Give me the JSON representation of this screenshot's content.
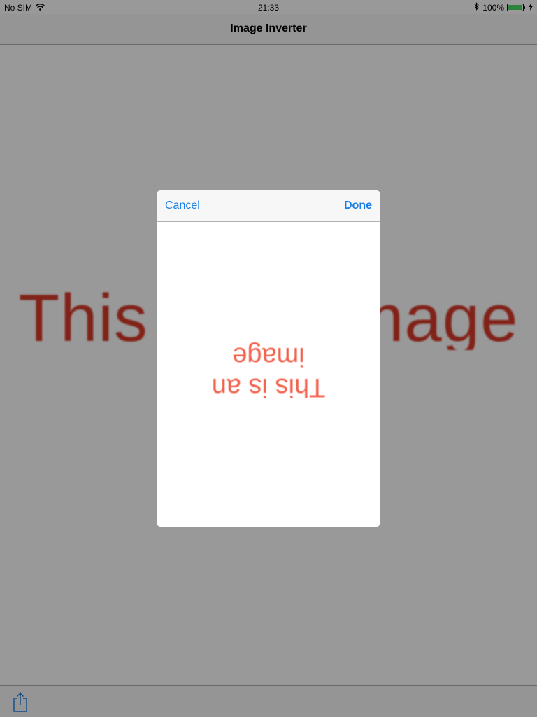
{
  "status_bar": {
    "carrier": "No SIM",
    "time": "21:33",
    "battery": "100%",
    "battery_level": 1.0,
    "icons": [
      "wifi-icon",
      "bluetooth-icon",
      "battery-icon",
      "charging-icon"
    ]
  },
  "nav_bar": {
    "title": "Image Inverter"
  },
  "main": {
    "image_text": "This is an image",
    "image_text_color": "#d83a2a"
  },
  "toolbar": {
    "icons": [
      "share-icon"
    ]
  },
  "modal": {
    "cancel_label": "Cancel",
    "done_label": "Done",
    "inverted_line1": "This is an",
    "inverted_line2": "image",
    "accent_color": "#1a7ee8",
    "text_color": "#f2604b"
  }
}
